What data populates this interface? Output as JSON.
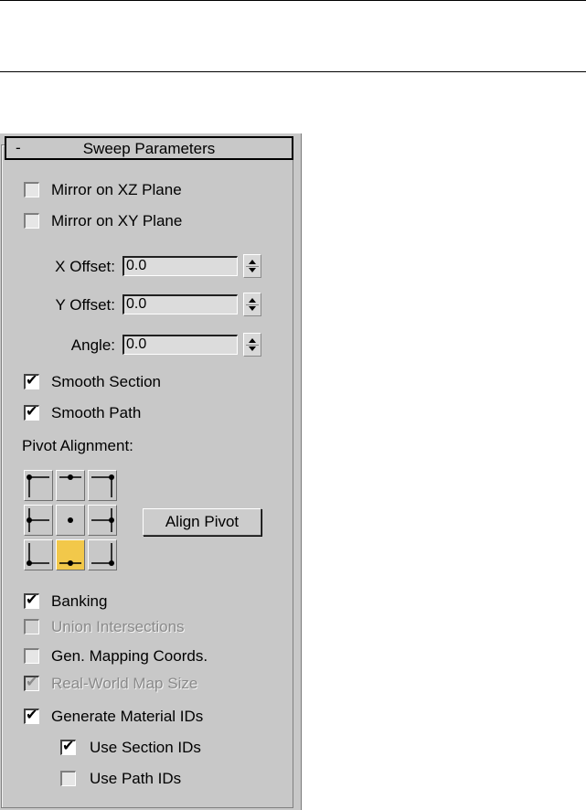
{
  "rollout": {
    "toggle": "-",
    "title": "Sweep Parameters"
  },
  "mirror_xz": {
    "label": "Mirror on XZ Plane",
    "checked": false,
    "enabled": true
  },
  "mirror_xy": {
    "label": "Mirror on XY Plane",
    "checked": false,
    "enabled": true
  },
  "x_offset": {
    "label": "X Offset:",
    "value": "0.0"
  },
  "y_offset": {
    "label": "Y Offset:",
    "value": "0.0"
  },
  "angle": {
    "label": "Angle:",
    "value": "0.0"
  },
  "smooth_section": {
    "label": "Smooth Section",
    "checked": true,
    "enabled": true
  },
  "smooth_path": {
    "label": "Smooth Path",
    "checked": true,
    "enabled": true
  },
  "pivot_alignment": {
    "label": "Pivot Alignment:",
    "selected": "bottom-center",
    "align_button": "Align Pivot"
  },
  "banking": {
    "label": "Banking",
    "checked": true,
    "enabled": true
  },
  "union_intersections": {
    "label": "Union Intersections",
    "checked": false,
    "enabled": false
  },
  "gen_mapping": {
    "label": "Gen. Mapping Coords.",
    "checked": false,
    "enabled": true
  },
  "real_world": {
    "label": "Real-World Map Size",
    "checked": true,
    "enabled": false
  },
  "gen_material_ids": {
    "label": "Generate Material IDs",
    "checked": true,
    "enabled": true
  },
  "use_section_ids": {
    "label": "Use Section IDs",
    "checked": true,
    "enabled": true
  },
  "use_path_ids": {
    "label": "Use Path IDs",
    "checked": false,
    "enabled": true
  },
  "colors": {
    "panel": "#c8c8c8",
    "selected_pivot": "#f2c84a"
  }
}
